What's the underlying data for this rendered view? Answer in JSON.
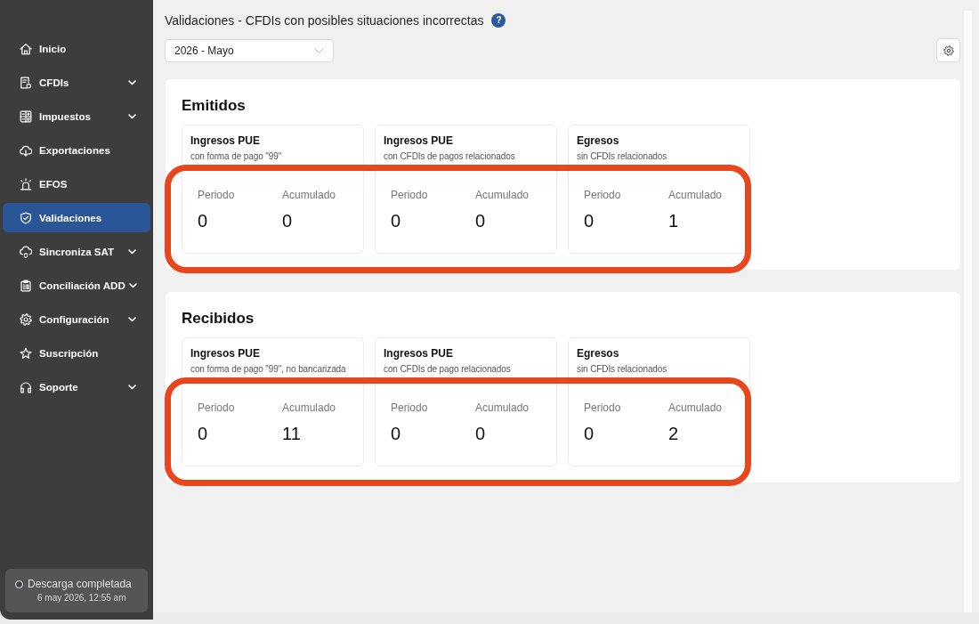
{
  "sidebar": {
    "items": [
      {
        "label": "Inicio",
        "kind": "link",
        "selected": false
      },
      {
        "label": "CFDIs",
        "kind": "group",
        "selected": false
      },
      {
        "label": "Impuestos",
        "kind": "group",
        "selected": false
      },
      {
        "label": "Exportaciones",
        "kind": "link",
        "selected": false
      },
      {
        "label": "EFOS",
        "kind": "link",
        "selected": false
      },
      {
        "label": "Validaciones",
        "kind": "link",
        "selected": true
      },
      {
        "label": "Sincroniza SAT",
        "kind": "group",
        "selected": false
      },
      {
        "label": "Conciliación ADD",
        "kind": "group",
        "selected": false
      },
      {
        "label": "Configuración",
        "kind": "group",
        "selected": false
      },
      {
        "label": "Suscripción",
        "kind": "link",
        "selected": false
      },
      {
        "label": "Soporte",
        "kind": "group",
        "selected": false
      }
    ],
    "status": {
      "text": "Descarga completada",
      "time": "6 may 2026, 12:55 am"
    }
  },
  "header": {
    "title": "Validaciones - CFDIs con posibles situaciones incorrectas",
    "help": "?",
    "period": "2026 - Mayo"
  },
  "sections": [
    {
      "title": "Emitidos",
      "highlighted": true,
      "cards": [
        {
          "title": "Ingresos PUE",
          "subtitle": "con forma de pago \"99\"",
          "metrics": [
            {
              "label": "Periodo",
              "value": "0"
            },
            {
              "label": "Acumulado",
              "value": "0"
            }
          ]
        },
        {
          "title": "Ingresos PUE",
          "subtitle": "con CFDIs de pagos relacionados",
          "metrics": [
            {
              "label": "Periodo",
              "value": "0"
            },
            {
              "label": "Acumulado",
              "value": "0"
            }
          ]
        },
        {
          "title": "Egresos",
          "subtitle": "sin CFDIs relacionados",
          "metrics": [
            {
              "label": "Periodo",
              "value": "0"
            },
            {
              "label": "Acumulado",
              "value": "1"
            }
          ]
        }
      ]
    },
    {
      "title": "Recibidos",
      "highlighted": true,
      "cards": [
        {
          "title": "Ingresos PUE",
          "subtitle": "con forma de pago \"99\", no bancarizada",
          "metrics": [
            {
              "label": "Periodo",
              "value": "0"
            },
            {
              "label": "Acumulado",
              "value": "11"
            }
          ]
        },
        {
          "title": "Ingresos PUE",
          "subtitle": "con CFDIs de pago relacionados",
          "metrics": [
            {
              "label": "Periodo",
              "value": "0"
            },
            {
              "label": "Acumulado",
              "value": "0"
            }
          ]
        },
        {
          "title": "Egresos",
          "subtitle": "sin CFDIs relacionados",
          "metrics": [
            {
              "label": "Periodo",
              "value": "0"
            },
            {
              "label": "Acumulado",
              "value": "2"
            }
          ]
        }
      ]
    }
  ]
}
